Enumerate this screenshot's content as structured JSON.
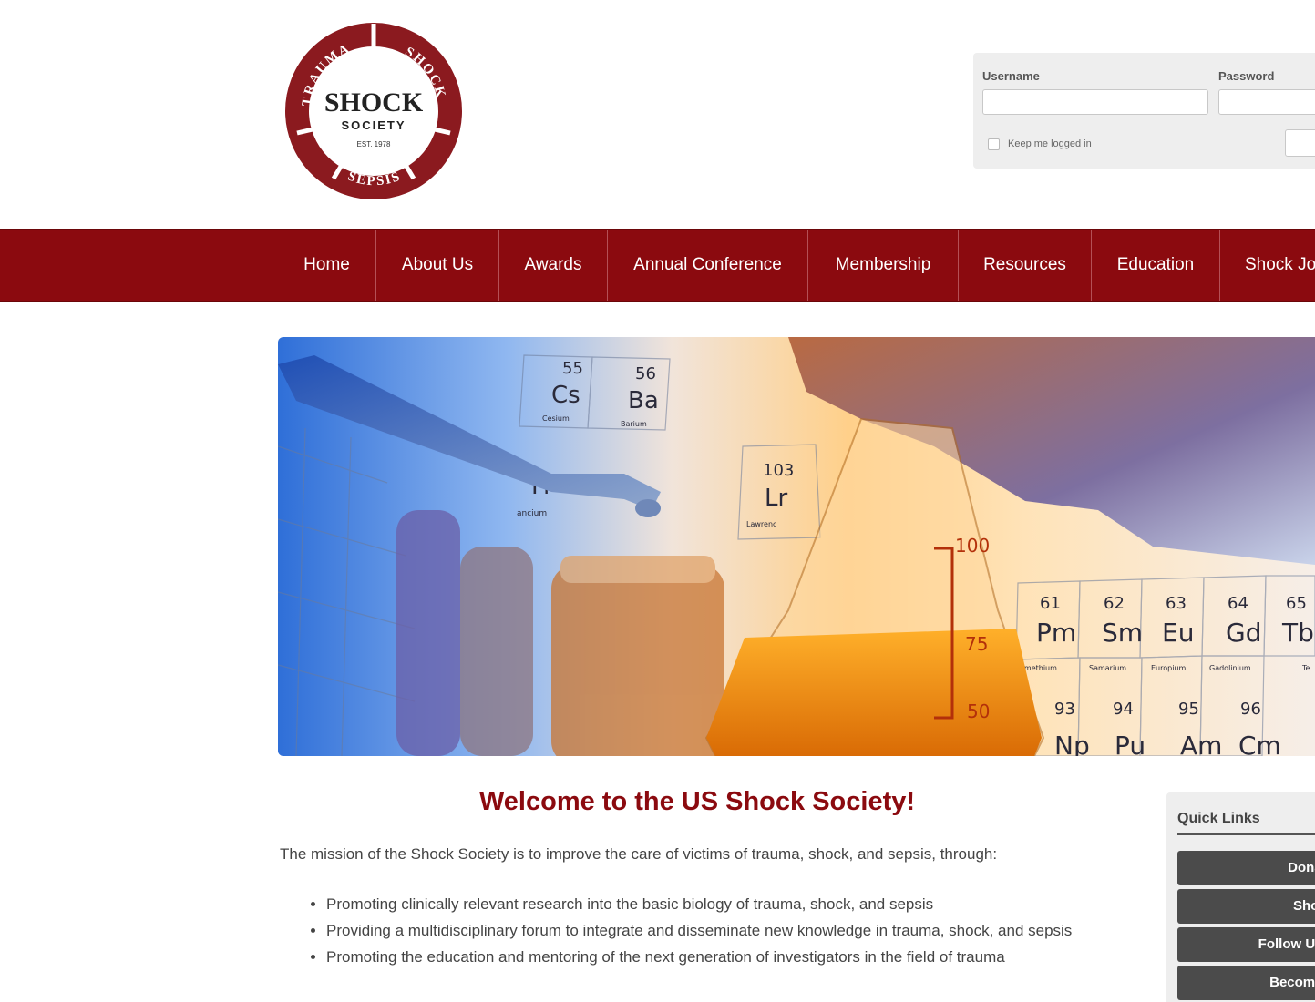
{
  "logo": {
    "title": "SHOCK",
    "subtitle": "SOCIETY",
    "established": "EST. 1978",
    "ring_top_left": "TRAUMA",
    "ring_top_right": "SHOCK",
    "ring_bottom": "SEPSIS",
    "ring_color": "#8b1a1f"
  },
  "login": {
    "username_label": "Username",
    "password_label": "Password",
    "remember_label": "Keep me logged in"
  },
  "nav": {
    "background": "#8b0a0f",
    "items": [
      "Home",
      "About Us",
      "Awards",
      "Annual Conference",
      "Membership",
      "Resources",
      "Education",
      "Shock Jo"
    ]
  },
  "hero": {
    "element_labels": [
      {
        "num": "55",
        "sym": "Cs",
        "name": "Cesium"
      },
      {
        "num": "56",
        "sym": "Ba",
        "name": "Barium"
      },
      {
        "num": "",
        "sym": "Fr",
        "name": "ancium"
      },
      {
        "num": "103",
        "sym": "Lr",
        "name": "Lawrenc"
      },
      {
        "num": "61",
        "sym": "Pm",
        "name": "omethium"
      },
      {
        "num": "62",
        "sym": "Sm",
        "name": "Samarium"
      },
      {
        "num": "63",
        "sym": "Eu",
        "name": "Europium"
      },
      {
        "num": "64",
        "sym": "Gd",
        "name": "Gadolinium"
      },
      {
        "num": "65",
        "sym": "Tb",
        "name": "Te"
      },
      {
        "num": "93",
        "sym": "Np",
        "name": ""
      },
      {
        "num": "94",
        "sym": "Pu",
        "name": ""
      },
      {
        "num": "95",
        "sym": "Am",
        "name": ""
      },
      {
        "num": "96",
        "sym": "Cm",
        "name": ""
      }
    ],
    "flask_marks": [
      "100",
      "75",
      "50"
    ]
  },
  "content": {
    "title": "Welcome to the US Shock Society!",
    "mission": "The mission of the Shock Society is to improve the care of victims of trauma, shock, and sepsis, through:",
    "bullets": [
      "Promoting clinically relevant research into the basic biology of trauma, shock, and sepsis",
      "Providing a multidisciplinary forum to integrate and disseminate new knowledge in trauma, shock, and sepsis",
      "Promoting the education and mentoring of the next generation of investigators in the field of trauma"
    ]
  },
  "quick_links": {
    "title": "Quick Links",
    "items": [
      "Donate",
      "Shock",
      "Follow Us c",
      "Become a"
    ]
  }
}
